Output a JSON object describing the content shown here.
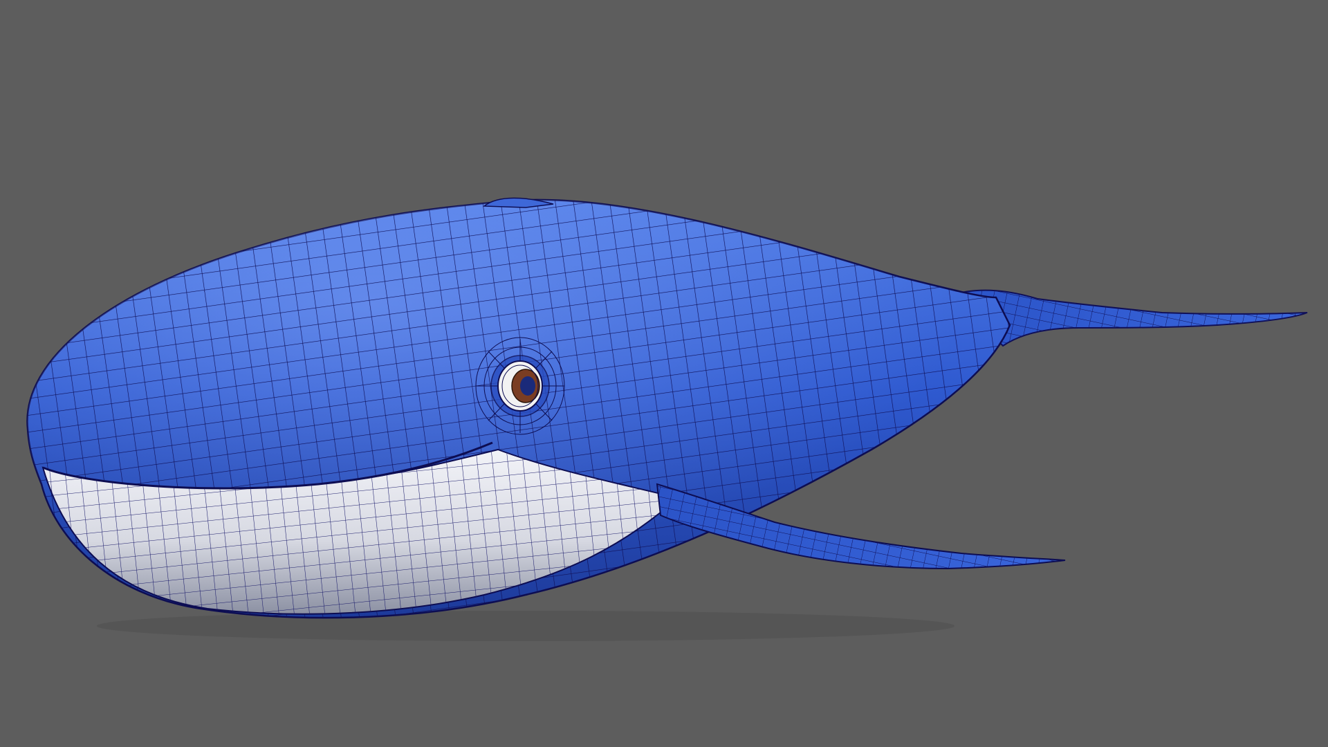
{
  "viewport": {
    "background_color": "#5d5d5d",
    "object": "whale-mesh"
  },
  "colors": {
    "body_blue": "#2f56c8",
    "body_blue_highlight": "#5b85ea",
    "body_blue_shadow": "#1e3b96",
    "belly_white": "#e6e8ef",
    "belly_shadow": "#9ba0b0",
    "wireframe": "#12125a",
    "eye_iris": "#7a3d22",
    "eye_pupil": "#1a2a7a",
    "eye_white": "#f2f2f2"
  }
}
